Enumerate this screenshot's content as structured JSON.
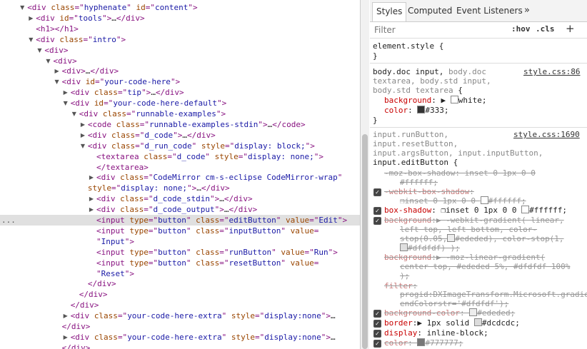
{
  "dom_tree": [
    {
      "indent": 2,
      "tri": "open",
      "parts": [
        [
          "tag",
          "<div "
        ],
        [
          "attr",
          "class"
        ],
        [
          "tag",
          "=\""
        ],
        [
          "val",
          "hyphenate"
        ],
        [
          "tag",
          "\" "
        ],
        [
          "attr",
          "id"
        ],
        [
          "tag",
          "=\""
        ],
        [
          "val",
          "content"
        ],
        [
          "tag",
          "\">"
        ]
      ]
    },
    {
      "indent": 3,
      "tri": "closed",
      "parts": [
        [
          "tag",
          "<div "
        ],
        [
          "attr",
          "id"
        ],
        [
          "tag",
          "=\""
        ],
        [
          "val",
          "tools"
        ],
        [
          "tag",
          "\">"
        ],
        [
          "txt",
          "…"
        ],
        [
          "tag",
          "</div>"
        ]
      ]
    },
    {
      "indent": 3,
      "tri": "",
      "parts": [
        [
          "tag",
          "<h1></h1>"
        ]
      ]
    },
    {
      "indent": 3,
      "tri": "open",
      "parts": [
        [
          "tag",
          "<div "
        ],
        [
          "attr",
          "class"
        ],
        [
          "tag",
          "=\""
        ],
        [
          "val",
          "intro"
        ],
        [
          "tag",
          "\">"
        ]
      ]
    },
    {
      "indent": 4,
      "tri": "open",
      "parts": [
        [
          "tag",
          "<div>"
        ]
      ]
    },
    {
      "indent": 5,
      "tri": "open",
      "parts": [
        [
          "tag",
          "<div>"
        ]
      ]
    },
    {
      "indent": 6,
      "tri": "closed",
      "parts": [
        [
          "tag",
          "<div>"
        ],
        [
          "txt",
          "…"
        ],
        [
          "tag",
          "</div>"
        ]
      ]
    },
    {
      "indent": 6,
      "tri": "open",
      "parts": [
        [
          "tag",
          "<div "
        ],
        [
          "attr",
          "id"
        ],
        [
          "tag",
          "=\""
        ],
        [
          "val",
          "your-code-here"
        ],
        [
          "tag",
          "\">"
        ]
      ]
    },
    {
      "indent": 7,
      "tri": "closed",
      "parts": [
        [
          "tag",
          "<div "
        ],
        [
          "attr",
          "class"
        ],
        [
          "tag",
          "=\""
        ],
        [
          "val",
          "tip"
        ],
        [
          "tag",
          "\">"
        ],
        [
          "txt",
          "…"
        ],
        [
          "tag",
          "</div>"
        ]
      ]
    },
    {
      "indent": 7,
      "tri": "open",
      "parts": [
        [
          "tag",
          "<div "
        ],
        [
          "attr",
          "id"
        ],
        [
          "tag",
          "=\""
        ],
        [
          "val",
          "your-code-here-default"
        ],
        [
          "tag",
          "\">"
        ]
      ]
    },
    {
      "indent": 8,
      "tri": "open",
      "parts": [
        [
          "tag",
          "<div "
        ],
        [
          "attr",
          "class"
        ],
        [
          "tag",
          "=\""
        ],
        [
          "val",
          "runnable-examples"
        ],
        [
          "tag",
          "\">"
        ]
      ]
    },
    {
      "indent": 9,
      "tri": "closed",
      "parts": [
        [
          "tag",
          "<code "
        ],
        [
          "attr",
          "class"
        ],
        [
          "tag",
          "=\""
        ],
        [
          "val",
          "runnable-examples-stdin"
        ],
        [
          "tag",
          "\">"
        ],
        [
          "txt",
          "…"
        ],
        [
          "tag",
          "</code>"
        ]
      ]
    },
    {
      "indent": 9,
      "tri": "closed",
      "parts": [
        [
          "tag",
          "<div "
        ],
        [
          "attr",
          "class"
        ],
        [
          "tag",
          "=\""
        ],
        [
          "val",
          "d_code"
        ],
        [
          "tag",
          "\">"
        ],
        [
          "txt",
          "…"
        ],
        [
          "tag",
          "</div>"
        ]
      ]
    },
    {
      "indent": 9,
      "tri": "open",
      "parts": [
        [
          "tag",
          "<div "
        ],
        [
          "attr",
          "class"
        ],
        [
          "tag",
          "=\""
        ],
        [
          "val",
          "d_run_code"
        ],
        [
          "tag",
          "\" "
        ],
        [
          "attr",
          "style"
        ],
        [
          "tag",
          "=\""
        ],
        [
          "val",
          "display: block;"
        ],
        [
          "tag",
          "\">"
        ]
      ]
    },
    {
      "indent": 10,
      "tri": "",
      "parts": [
        [
          "tag",
          "<textarea "
        ],
        [
          "attr",
          "class"
        ],
        [
          "tag",
          "=\""
        ],
        [
          "val",
          "d_code"
        ],
        [
          "tag",
          "\" "
        ],
        [
          "attr",
          "style"
        ],
        [
          "tag",
          "=\""
        ],
        [
          "val",
          "display: none;"
        ],
        [
          "tag",
          "\">"
        ]
      ]
    },
    {
      "indent": 10,
      "tri": "",
      "parts": [
        [
          "tag",
          "</textarea>"
        ]
      ]
    },
    {
      "indent": 10,
      "tri": "closed",
      "parts": [
        [
          "tag",
          "<div "
        ],
        [
          "attr",
          "class"
        ],
        [
          "tag",
          "=\""
        ],
        [
          "val",
          "CodeMirror cm-s-eclipse CodeMirror-wrap"
        ],
        [
          "tag",
          "\""
        ]
      ]
    },
    {
      "indent": 9,
      "tri": "",
      "parts": [
        [
          "attr",
          "style"
        ],
        [
          "tag",
          "=\""
        ],
        [
          "val",
          "display: none;"
        ],
        [
          "tag",
          "\">"
        ],
        [
          "txt",
          "…"
        ],
        [
          "tag",
          "</div>"
        ]
      ]
    },
    {
      "indent": 10,
      "tri": "closed",
      "parts": [
        [
          "tag",
          "<div "
        ],
        [
          "attr",
          "class"
        ],
        [
          "tag",
          "=\""
        ],
        [
          "val",
          "d_code_stdin"
        ],
        [
          "tag",
          "\">"
        ],
        [
          "txt",
          "…"
        ],
        [
          "tag",
          "</div>"
        ]
      ]
    },
    {
      "indent": 10,
      "tri": "closed",
      "parts": [
        [
          "tag",
          "<div "
        ],
        [
          "attr",
          "class"
        ],
        [
          "tag",
          "=\""
        ],
        [
          "val",
          "d_code_output"
        ],
        [
          "tag",
          "\">"
        ],
        [
          "txt",
          "…"
        ],
        [
          "tag",
          "</div>"
        ]
      ]
    },
    {
      "indent": 10,
      "tri": "",
      "selected": true,
      "parts": [
        [
          "tag",
          "<input "
        ],
        [
          "attr",
          "type"
        ],
        [
          "tag",
          "=\""
        ],
        [
          "val",
          "button"
        ],
        [
          "tag",
          "\" "
        ],
        [
          "attr",
          "class"
        ],
        [
          "tag",
          "=\""
        ],
        [
          "val",
          "editButton"
        ],
        [
          "tag",
          "\" "
        ],
        [
          "attr",
          "value"
        ],
        [
          "tag",
          "=\""
        ],
        [
          "val",
          "Edit"
        ],
        [
          "tag",
          "\">"
        ]
      ]
    },
    {
      "indent": 10,
      "tri": "",
      "parts": [
        [
          "tag",
          "<input "
        ],
        [
          "attr",
          "type"
        ],
        [
          "tag",
          "=\""
        ],
        [
          "val",
          "button"
        ],
        [
          "tag",
          "\" "
        ],
        [
          "attr",
          "class"
        ],
        [
          "tag",
          "=\""
        ],
        [
          "val",
          "inputButton"
        ],
        [
          "tag",
          "\" "
        ],
        [
          "attr",
          "value"
        ],
        [
          "tag",
          "="
        ]
      ]
    },
    {
      "indent": 10,
      "tri": "",
      "parts": [
        [
          "tag",
          "\""
        ],
        [
          "val",
          "Input"
        ],
        [
          "tag",
          "\">"
        ]
      ]
    },
    {
      "indent": 10,
      "tri": "",
      "parts": [
        [
          "tag",
          "<input "
        ],
        [
          "attr",
          "type"
        ],
        [
          "tag",
          "=\""
        ],
        [
          "val",
          "button"
        ],
        [
          "tag",
          "\" "
        ],
        [
          "attr",
          "class"
        ],
        [
          "tag",
          "=\""
        ],
        [
          "val",
          "runButton"
        ],
        [
          "tag",
          "\" "
        ],
        [
          "attr",
          "value"
        ],
        [
          "tag",
          "=\""
        ],
        [
          "val",
          "Run"
        ],
        [
          "tag",
          "\">"
        ]
      ]
    },
    {
      "indent": 10,
      "tri": "",
      "parts": [
        [
          "tag",
          "<input "
        ],
        [
          "attr",
          "type"
        ],
        [
          "tag",
          "=\""
        ],
        [
          "val",
          "button"
        ],
        [
          "tag",
          "\" "
        ],
        [
          "attr",
          "class"
        ],
        [
          "tag",
          "=\""
        ],
        [
          "val",
          "resetButton"
        ],
        [
          "tag",
          "\" "
        ],
        [
          "attr",
          "value"
        ],
        [
          "tag",
          "="
        ]
      ]
    },
    {
      "indent": 10,
      "tri": "",
      "parts": [
        [
          "tag",
          "\""
        ],
        [
          "val",
          "Reset"
        ],
        [
          "tag",
          "\">"
        ]
      ]
    },
    {
      "indent": 9,
      "tri": "",
      "parts": [
        [
          "tag",
          "</div>"
        ]
      ]
    },
    {
      "indent": 8,
      "tri": "",
      "parts": [
        [
          "tag",
          "</div>"
        ]
      ]
    },
    {
      "indent": 7,
      "tri": "",
      "parts": [
        [
          "tag",
          "</div>"
        ]
      ]
    },
    {
      "indent": 7,
      "tri": "closed",
      "parts": [
        [
          "tag",
          "<div "
        ],
        [
          "attr",
          "class"
        ],
        [
          "tag",
          "=\""
        ],
        [
          "val",
          "your-code-here-extra"
        ],
        [
          "tag",
          "\" "
        ],
        [
          "attr",
          "style"
        ],
        [
          "tag",
          "=\""
        ],
        [
          "val",
          "display:none"
        ],
        [
          "tag",
          "\">"
        ],
        [
          "txt",
          "…"
        ]
      ]
    },
    {
      "indent": 6,
      "tri": "",
      "parts": [
        [
          "tag",
          "</div>"
        ]
      ]
    },
    {
      "indent": 7,
      "tri": "closed",
      "parts": [
        [
          "tag",
          "<div "
        ],
        [
          "attr",
          "class"
        ],
        [
          "tag",
          "=\""
        ],
        [
          "val",
          "your-code-here-extra"
        ],
        [
          "tag",
          "\" "
        ],
        [
          "attr",
          "style"
        ],
        [
          "tag",
          "=\""
        ],
        [
          "val",
          "display:none"
        ],
        [
          "tag",
          "\">"
        ],
        [
          "txt",
          "…"
        ]
      ]
    },
    {
      "indent": 6,
      "tri": "",
      "parts": [
        [
          "tag",
          "</div>"
        ]
      ]
    },
    {
      "indent": 6,
      "tri": "",
      "parts": [
        [
          "tag",
          "</div>"
        ]
      ]
    }
  ],
  "selected_marker": "...",
  "tabs": {
    "styles": "Styles",
    "computed": "Computed",
    "listeners": "Event Listeners",
    "more": "»"
  },
  "filter": {
    "placeholder": "Filter",
    "hov": ":hov",
    "cls": ".cls",
    "add": "+"
  },
  "element_style": {
    "selector": "element.style {",
    "close": "}"
  },
  "rule1": {
    "selector_main": "body.doc input,",
    "selector_gray_a": " body.doc",
    "selector_gray_b": "textarea, body.std input,",
    "selector_gray_c": "body.std textarea",
    "brace": " {",
    "source": "style.css:86",
    "decls": [
      {
        "prop": "background",
        "value": "white;",
        "arrow": true,
        "swatch": "#ffffff"
      },
      {
        "prop": "color",
        "value": "#333;",
        "swatch": "#333333"
      }
    ],
    "close": "}"
  },
  "rule2": {
    "sel_gray_1": "input.runButton,",
    "sel_gray_2": "input.resetButton,",
    "sel_gray_3": "input.argsButton, input.inputButton,",
    "sel_main": "input.editButton",
    "brace": " {",
    "source": "style.css:1690",
    "lines": {
      "moz_shadow_a": "-moz-box-shadow: inset 0 1px 0 0",
      "moz_shadow_b": "#ffffff;",
      "webkit_shadow_prop": "-webkit-box-shadow",
      "webkit_shadow_val": "inset 0 1px 0 0",
      "webkit_shadow_col": "#ffffff;",
      "box_shadow_prop": "box-shadow",
      "box_shadow_val": "inset 0 1px 0 0",
      "box_shadow_col": "#ffffff;",
      "bg1_prop": "background",
      "bg1_a": "-webkit-gradient( linear,",
      "bg1_b": "left top, left bottom, color-",
      "bg1_c": "stop(0.05,",
      "bg1_c2": "#ededed), color-stop(1,",
      "bg1_d": "#dfdfdf) );",
      "bg2_prop": "background",
      "bg2_a": "-moz-linear-gradient(",
      "bg2_b": "center top, #ededed 5%, #dfdfdf 100%",
      "bg2_c": ");",
      "filter_prop": "filter",
      "filter_a": "progid:DXImageTransform.Microsoft.gradient(startColorstr='#ededed',",
      "filter_b": "endColorstr='#dfdfdf');",
      "bgc_prop": "background-color",
      "bgc_val": "#ededed;",
      "border_prop": "border",
      "border_val": "1px solid",
      "border_col": "#dcdcdc;",
      "display_prop": "display",
      "display_val": "inline-block;",
      "color_prop": "color",
      "color_val": "#777777;"
    }
  },
  "colors": {
    "tag": "#881280",
    "attr": "#994500",
    "val": "#1a1aa6",
    "prop": "#c80000",
    "selected_row": "#e0e0e0"
  }
}
